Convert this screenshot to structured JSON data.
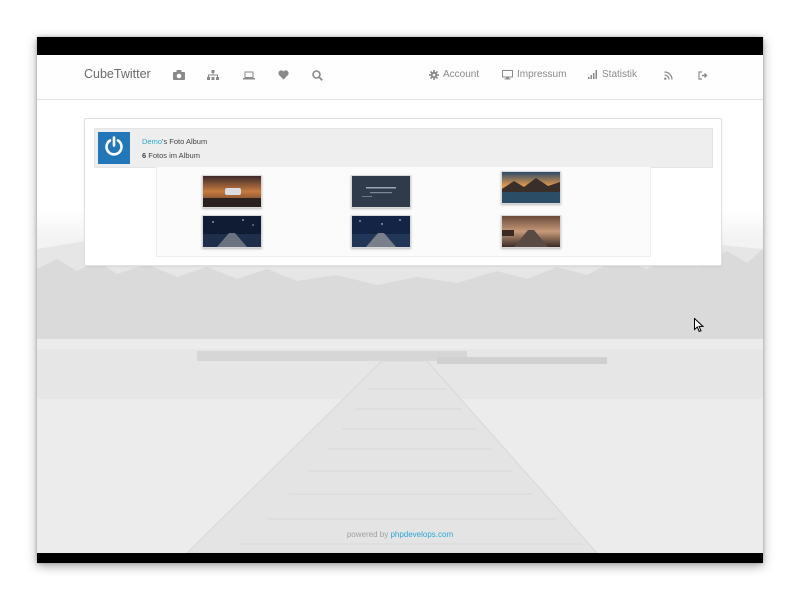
{
  "navbar": {
    "brand": "CubeTwitter",
    "icons": [
      "camera-icon",
      "sitemap-icon",
      "laptop-icon",
      "heart-icon",
      "search-icon"
    ],
    "links": [
      {
        "label": "Account",
        "icon": "gear-icon"
      },
      {
        "label": "Impressum",
        "icon": "desktop-icon"
      },
      {
        "label": "Statistik",
        "icon": "signal-icon"
      }
    ],
    "extra_icons": [
      "rss-icon",
      "sign-out-icon"
    ]
  },
  "album": {
    "user": "Demo",
    "title_suffix": "'s Foto Album",
    "count": "6",
    "count_suffix": " Fotos im Album",
    "avatar_icon": "power-icon",
    "avatar_color": "#2277b8"
  },
  "photos": [
    {
      "name": "photo-car-sunset"
    },
    {
      "name": "photo-dark-text"
    },
    {
      "name": "photo-mountain-lake"
    },
    {
      "name": "photo-pier-night"
    },
    {
      "name": "photo-pier-stars"
    },
    {
      "name": "photo-road-dusk"
    }
  ],
  "footer": {
    "prefix": "powered by ",
    "link": "phpdevelops.com"
  },
  "colors": {
    "accent": "#29a8d7",
    "nav_text": "#8a8a8a"
  }
}
